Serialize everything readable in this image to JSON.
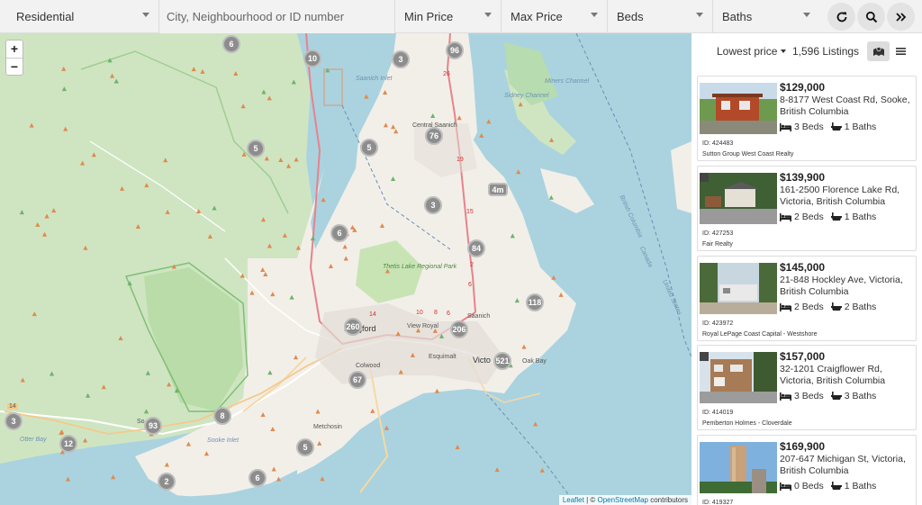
{
  "filters": {
    "property_type": "Residential",
    "search_placeholder": "City, Neighbourhood or ID number",
    "min_price": "Min Price",
    "max_price": "Max Price",
    "beds": "Beds",
    "baths": "Baths",
    "buttons": [
      {
        "name": "refresh-button",
        "icon": "refresh-icon"
      },
      {
        "name": "search-button",
        "icon": "search-icon"
      },
      {
        "name": "expand-button",
        "icon": "double-chevron-right-icon"
      }
    ]
  },
  "map": {
    "zoom_in": "+",
    "zoom_out": "−",
    "labels": {
      "saanich_inlet": "Saanich Inlet",
      "sidney_channel": "Sidney Channel",
      "miners_channel": "Miners Channel",
      "central_saanich": "Central Saanich",
      "thetis_lake": "Thetis Lake Regional Park",
      "saanich": "Saanich",
      "langford": "Langford",
      "view_royal": "View Royal",
      "colwood": "Colwood",
      "esquimalt": "Esquimalt",
      "victoria": "Victo",
      "oak_bay": "Oak Bay",
      "metchosin": "Metchosin",
      "sooke": "So",
      "sooke_inlet": "Sooke Inlet",
      "otter_bay": "Otter Bay",
      "british_columbia": "British Columbia",
      "canada": "Canada",
      "united_states": "United States",
      "road_14": "14",
      "road_1_14": "14",
      "road_1_10": "10",
      "road_1_8": "8",
      "road_1_6": "6",
      "hwy_17_26": "26",
      "hwy_17_19": "19",
      "hwy_17_15": "15",
      "hwy_17_2": "2",
      "hwy_17_6": "6"
    },
    "clusters": [
      {
        "label": "6"
      },
      {
        "label": "10"
      },
      {
        "label": "3"
      },
      {
        "label": "96"
      },
      {
        "label": "5"
      },
      {
        "label": "5"
      },
      {
        "label": "76"
      },
      {
        "label": "4m"
      },
      {
        "label": "3"
      },
      {
        "label": "6"
      },
      {
        "label": "84"
      },
      {
        "label": "118"
      },
      {
        "label": "260"
      },
      {
        "label": "206"
      },
      {
        "label": "521"
      },
      {
        "label": "67"
      },
      {
        "label": "3"
      },
      {
        "label": "93"
      },
      {
        "label": "8"
      },
      {
        "label": "12"
      },
      {
        "label": "5"
      },
      {
        "label": "2"
      },
      {
        "label": "6"
      }
    ],
    "attribution": {
      "leaflet": "Leaflet",
      "sep": " | © ",
      "osm": "OpenStreetMap",
      "rest": " contributors"
    }
  },
  "listings_panel": {
    "sort_label": "Lowest price",
    "count": "1,596 Listings",
    "view_buttons": [
      {
        "name": "map-view-button",
        "icon": "map-icon"
      },
      {
        "name": "list-view-button",
        "icon": "list-icon"
      }
    ],
    "listings": [
      {
        "price": "$129,000",
        "address": "8-8177 West Coast Rd, Sooke, British Columbia",
        "beds": "3 Beds",
        "baths": "1 Baths",
        "id": "ID: 424483",
        "agency": "Sutton Group West Coast Realty"
      },
      {
        "price": "$139,900",
        "address": "161-2500 Florence Lake Rd, Victoria, British Columbia",
        "beds": "2 Beds",
        "baths": "1 Baths",
        "id": "ID: 427253",
        "agency": "Fair Realty"
      },
      {
        "price": "$145,000",
        "address": "21-848 Hockley Ave, Victoria, British Columbia",
        "beds": "2 Beds",
        "baths": "2 Baths",
        "id": "ID: 423972",
        "agency": "Royal LePage Coast Capital - Westshore"
      },
      {
        "price": "$157,000",
        "address": "32-1201 Craigflower Rd, Victoria, British Columbia",
        "beds": "3 Beds",
        "baths": "3 Baths",
        "id": "ID: 414019",
        "agency": "Pemberton Holmes - Cloverdale"
      },
      {
        "price": "$169,900",
        "address": "207-647 Michigan St, Victoria, British Columbia",
        "beds": "0 Beds",
        "baths": "1 Baths",
        "id": "ID: 419327",
        "agency": ""
      }
    ]
  },
  "colors": {
    "water": "#aad3df",
    "land": "#f2efe9",
    "forest": "#cde3c0",
    "park": "#a9d49a",
    "cluster": "#8d8d8d",
    "highway": "#e8828c"
  }
}
